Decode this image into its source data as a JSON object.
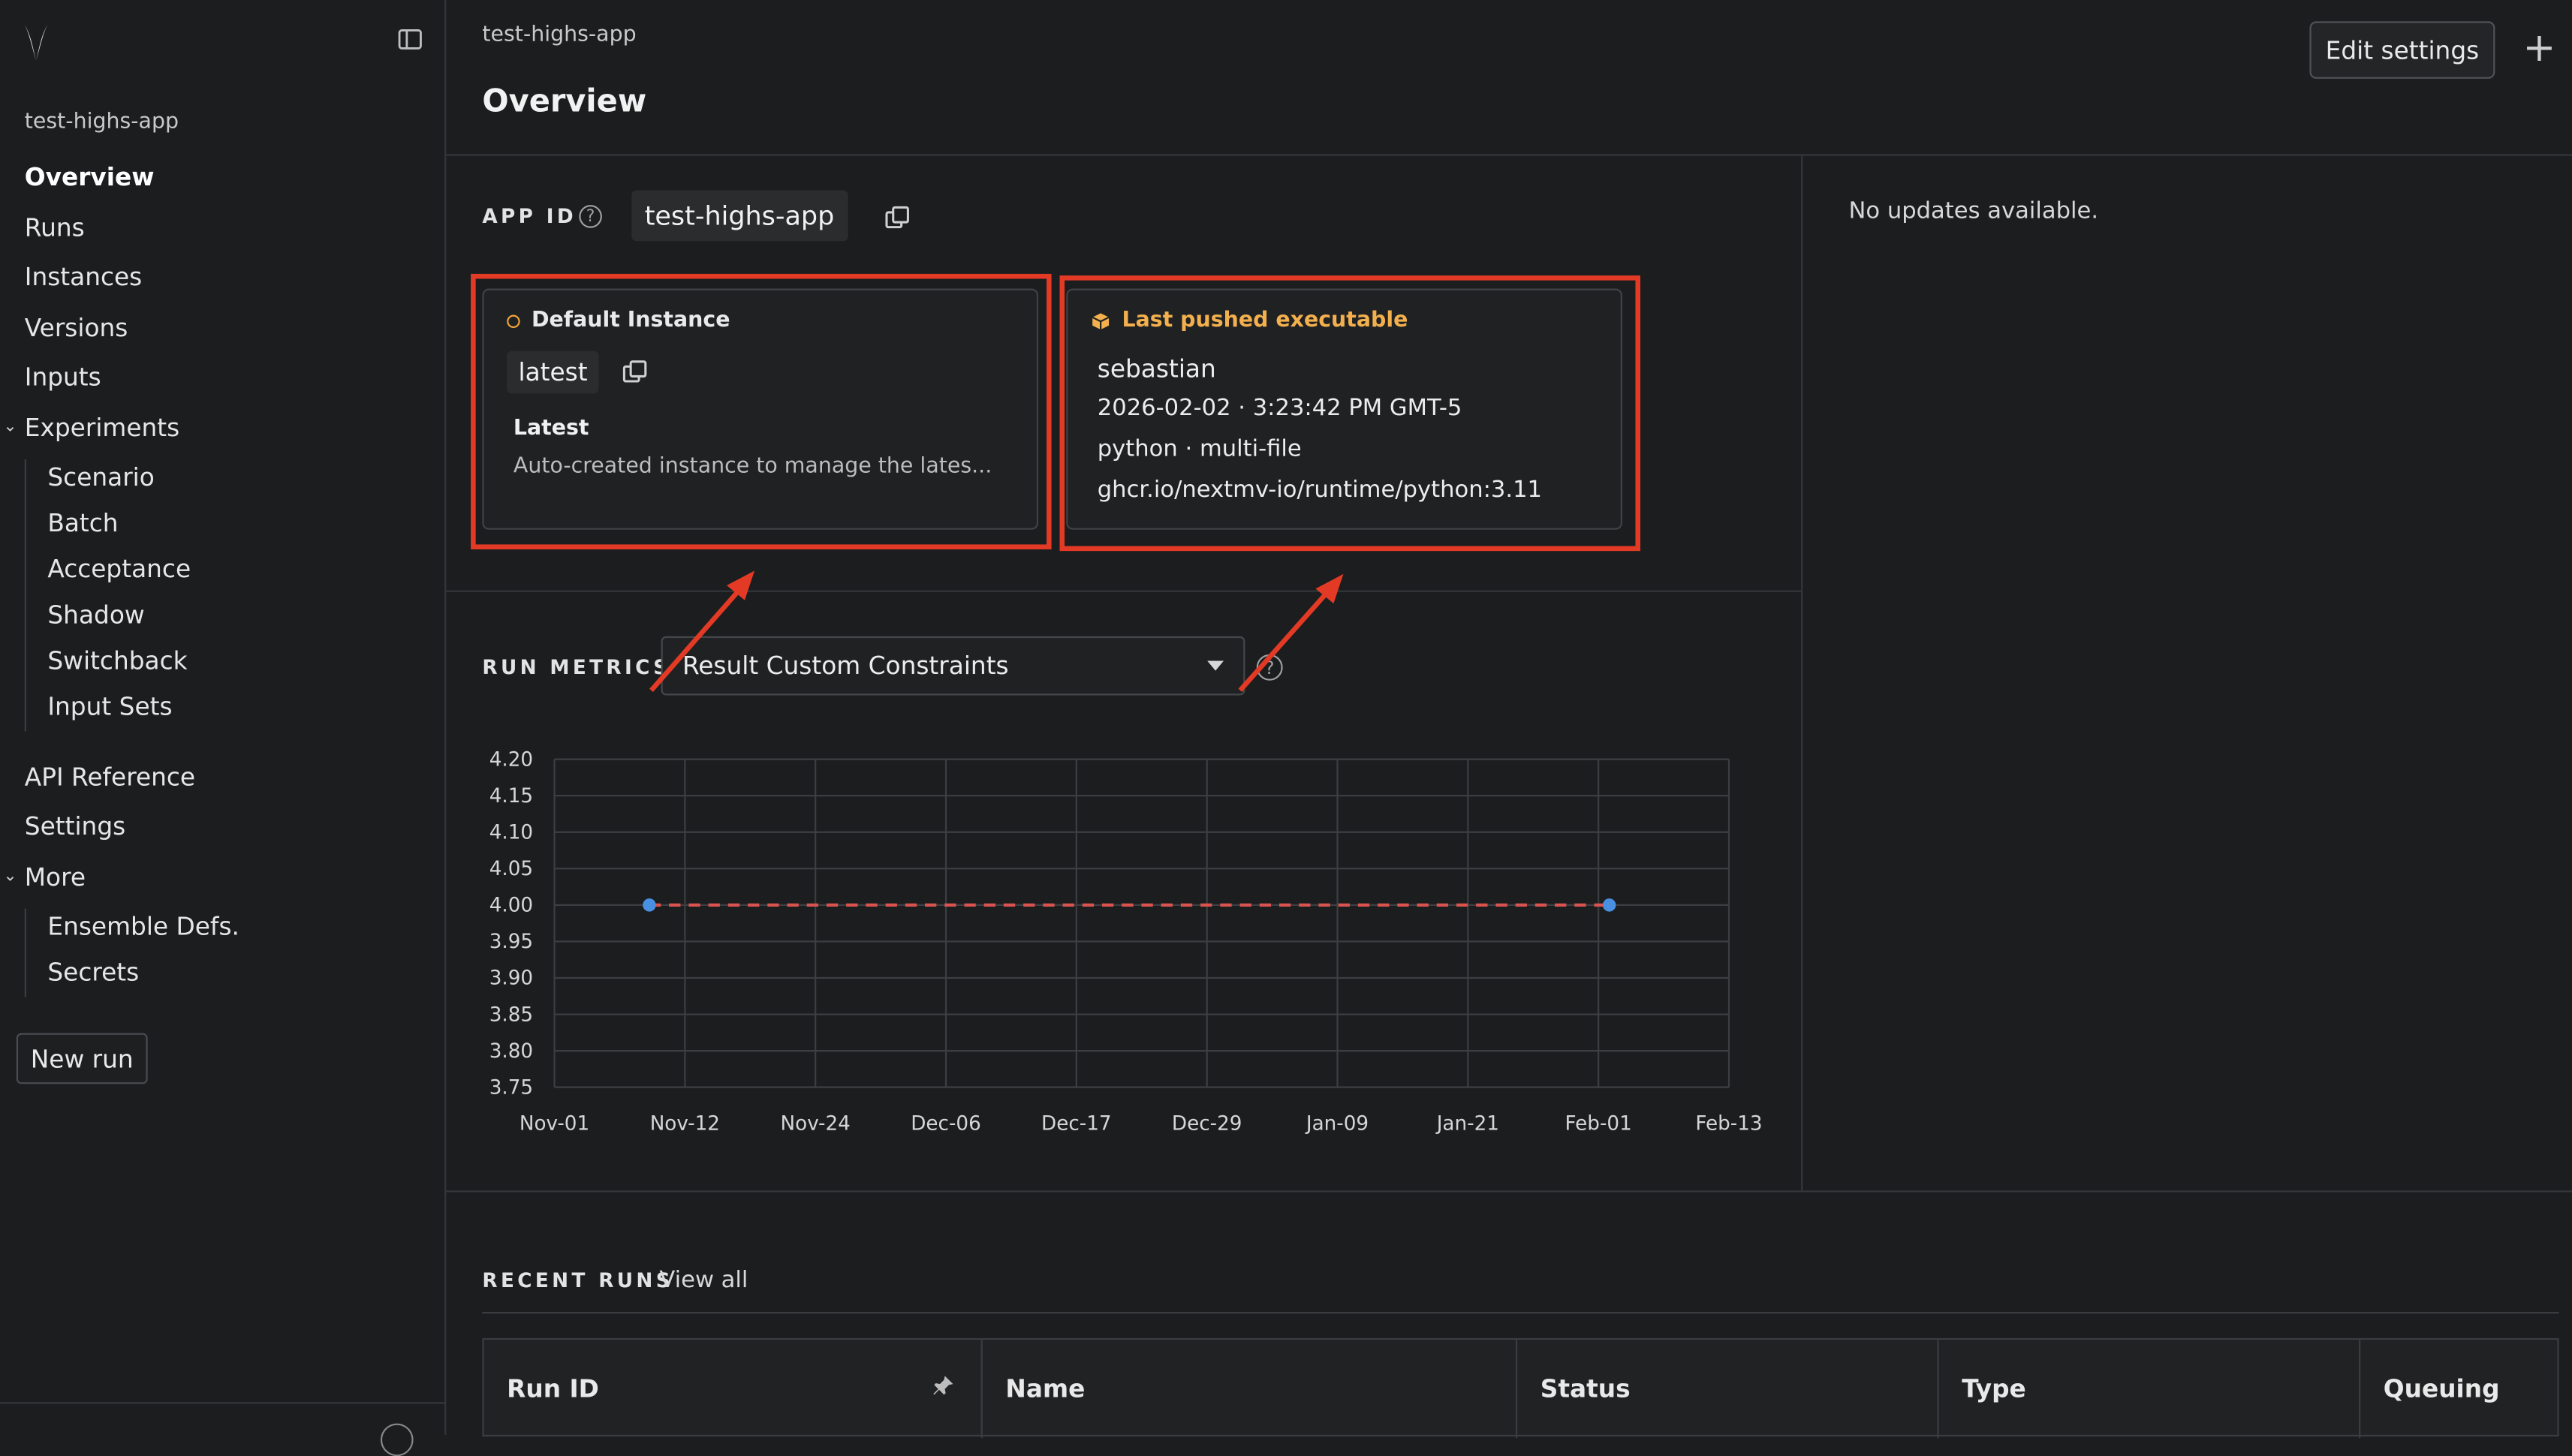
{
  "app": {
    "name": "test-highs-app"
  },
  "sidebar": {
    "app_name": "test-highs-app",
    "items": [
      {
        "label": "Overview",
        "active": true
      },
      {
        "label": "Runs"
      },
      {
        "label": "Instances"
      },
      {
        "label": "Versions"
      },
      {
        "label": "Inputs"
      },
      {
        "label": "Experiments",
        "expanded": true,
        "children": [
          "Scenario",
          "Batch",
          "Acceptance",
          "Shadow",
          "Switchback",
          "Input Sets"
        ]
      },
      {
        "label": "API Reference"
      },
      {
        "label": "Settings"
      },
      {
        "label": "More",
        "expanded": true,
        "children": [
          "Ensemble Defs.",
          "Secrets"
        ]
      }
    ],
    "new_run_label": "New run"
  },
  "header": {
    "breadcrumb": "test-highs-app",
    "title": "Overview",
    "edit_settings_label": "Edit settings",
    "add_icon": "plus-icon"
  },
  "app_id": {
    "label": "APP ID",
    "value": "test-highs-app",
    "help_icon": "question-icon",
    "copy_icon": "copy-icon"
  },
  "default_instance": {
    "header": "Default Instance",
    "id": "latest",
    "title": "Latest",
    "description": "Auto-created instance to manage the lates..."
  },
  "executable": {
    "header": "Last pushed executable",
    "user": "sebastian",
    "timestamp": "2026-02-02 · 3:23:42 PM GMT-5",
    "runtime": "python · multi-file",
    "image": "ghcr.io/nextmv-io/runtime/python:3.11"
  },
  "updates_text": "No updates available.",
  "run_metrics": {
    "label": "RUN METRICS",
    "selected": "Result Custom Constraints"
  },
  "chart_data": {
    "type": "line",
    "y_ticks": [
      "4.20",
      "4.15",
      "4.10",
      "4.05",
      "4.00",
      "3.95",
      "3.90",
      "3.85",
      "3.80",
      "3.75"
    ],
    "ylim": [
      3.75,
      4.2
    ],
    "x_ticks": [
      "Nov-01",
      "Nov-12",
      "Nov-24",
      "Dec-06",
      "Dec-17",
      "Dec-29",
      "Jan-09",
      "Jan-21",
      "Feb-01",
      "Feb-13"
    ],
    "series": [
      {
        "points": [
          {
            "x": "Nov-09",
            "y": 4.0
          },
          {
            "x": "Feb-02",
            "y": 4.0
          }
        ]
      }
    ],
    "grid": true,
    "line_color": "#d9534f",
    "point_color": "#4a90e2"
  },
  "recent_runs": {
    "label": "RECENT RUNS",
    "view_all": "View all",
    "columns": [
      "Run ID",
      "Name",
      "Status",
      "Type",
      "Queuing"
    ]
  },
  "colors": {
    "annotation_red": "#e23a25",
    "instance_dot": "#f0a53a",
    "executable_accent": "#f3b04d"
  }
}
